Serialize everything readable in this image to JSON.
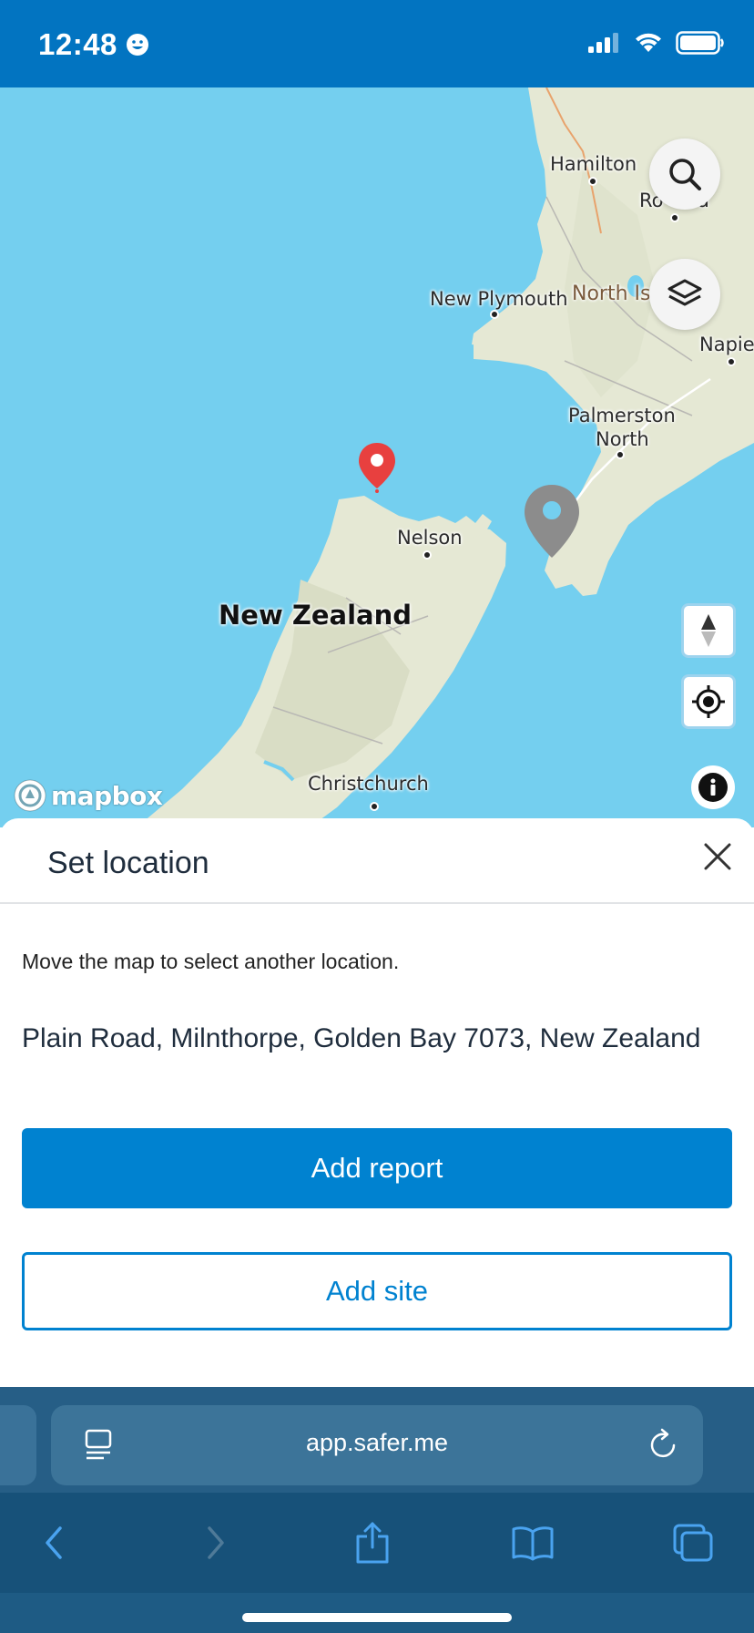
{
  "status_bar": {
    "time": "12:48",
    "icons": [
      "smiley-icon",
      "cellular-signal-icon",
      "wifi-icon",
      "battery-icon"
    ]
  },
  "map": {
    "labels": {
      "hamilton": "Hamilton",
      "rotorua": "Ro",
      "rotorua_tail": "a",
      "new_plymouth": "New Plymouth",
      "north_island": "North Is",
      "napier": "Napier",
      "palmerston_1": "Palmerston",
      "palmerston_2": "North",
      "nelson": "Nelson",
      "new_zealand": "New Zealand",
      "christchurch": "Christchurch"
    },
    "attribution": "mapbox",
    "controls": [
      "search-icon",
      "layers-icon",
      "compass-icon",
      "locate-icon",
      "info-icon"
    ],
    "colors": {
      "water": "#74cfef",
      "land": "#e6e9d6",
      "selected_pin": "#e8403f",
      "other_pin": "#8c8c8c"
    }
  },
  "sheet": {
    "title": "Set location",
    "hint": "Move the map to select another location.",
    "address": "Plain Road, Milnthorpe, Golden Bay 7073, New Zealand",
    "primary_button": "Add report",
    "secondary_button": "Add site",
    "accent": "#0082d0"
  },
  "browser": {
    "url": "app.safer.me",
    "icons": [
      "reader-icon",
      "reload-icon",
      "back-icon",
      "forward-icon",
      "share-icon",
      "bookmarks-icon",
      "tabs-icon"
    ]
  }
}
